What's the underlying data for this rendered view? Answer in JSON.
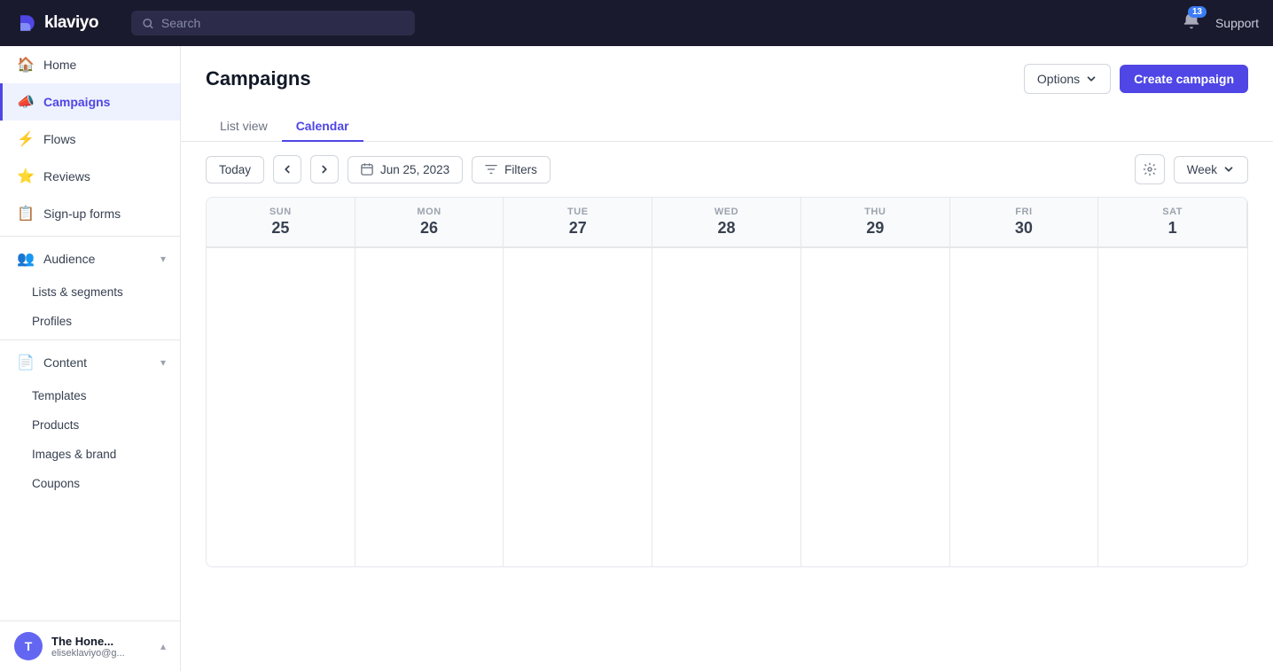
{
  "topnav": {
    "logo": "klaviyo",
    "search_placeholder": "Search",
    "notification_count": "13",
    "support_label": "Support"
  },
  "sidebar": {
    "items": [
      {
        "id": "home",
        "label": "Home",
        "icon": "🏠"
      },
      {
        "id": "campaigns",
        "label": "Campaigns",
        "icon": "📣",
        "active": true
      },
      {
        "id": "flows",
        "label": "Flows",
        "icon": "⚡"
      },
      {
        "id": "reviews",
        "label": "Reviews",
        "icon": "⭐"
      },
      {
        "id": "sign-up-forms",
        "label": "Sign-up forms",
        "icon": "📋"
      },
      {
        "id": "audience",
        "label": "Audience",
        "icon": "👥"
      },
      {
        "id": "lists-segments",
        "label": "Lists & segments",
        "icon": "",
        "sub": true
      },
      {
        "id": "profiles",
        "label": "Profiles",
        "icon": "",
        "sub": true
      },
      {
        "id": "content",
        "label": "Content",
        "icon": "📄"
      },
      {
        "id": "templates",
        "label": "Templates",
        "icon": "",
        "sub": true
      },
      {
        "id": "products",
        "label": "Products",
        "icon": "",
        "sub": true
      },
      {
        "id": "images-brand",
        "label": "Images & brand",
        "icon": "",
        "sub": true
      },
      {
        "id": "coupons",
        "label": "Coupons",
        "icon": "",
        "sub": true
      }
    ],
    "user": {
      "initials": "T",
      "name": "The Hone...",
      "email": "eliseklaviyo@g..."
    }
  },
  "page": {
    "title": "Campaigns",
    "options_label": "Options",
    "create_label": "Create campaign"
  },
  "tabs": [
    {
      "id": "list-view",
      "label": "List view",
      "active": false
    },
    {
      "id": "calendar",
      "label": "Calendar",
      "active": true
    }
  ],
  "toolbar": {
    "today_label": "Today",
    "date_label": "Jun 25, 2023",
    "filters_label": "Filters",
    "week_label": "Week"
  },
  "calendar": {
    "days": [
      {
        "name": "SUN",
        "num": "25"
      },
      {
        "name": "MON",
        "num": "26"
      },
      {
        "name": "TUE",
        "num": "27"
      },
      {
        "name": "WED",
        "num": "28"
      },
      {
        "name": "THU",
        "num": "29"
      },
      {
        "name": "FRI",
        "num": "30"
      },
      {
        "name": "SAT",
        "num": "1"
      }
    ]
  }
}
